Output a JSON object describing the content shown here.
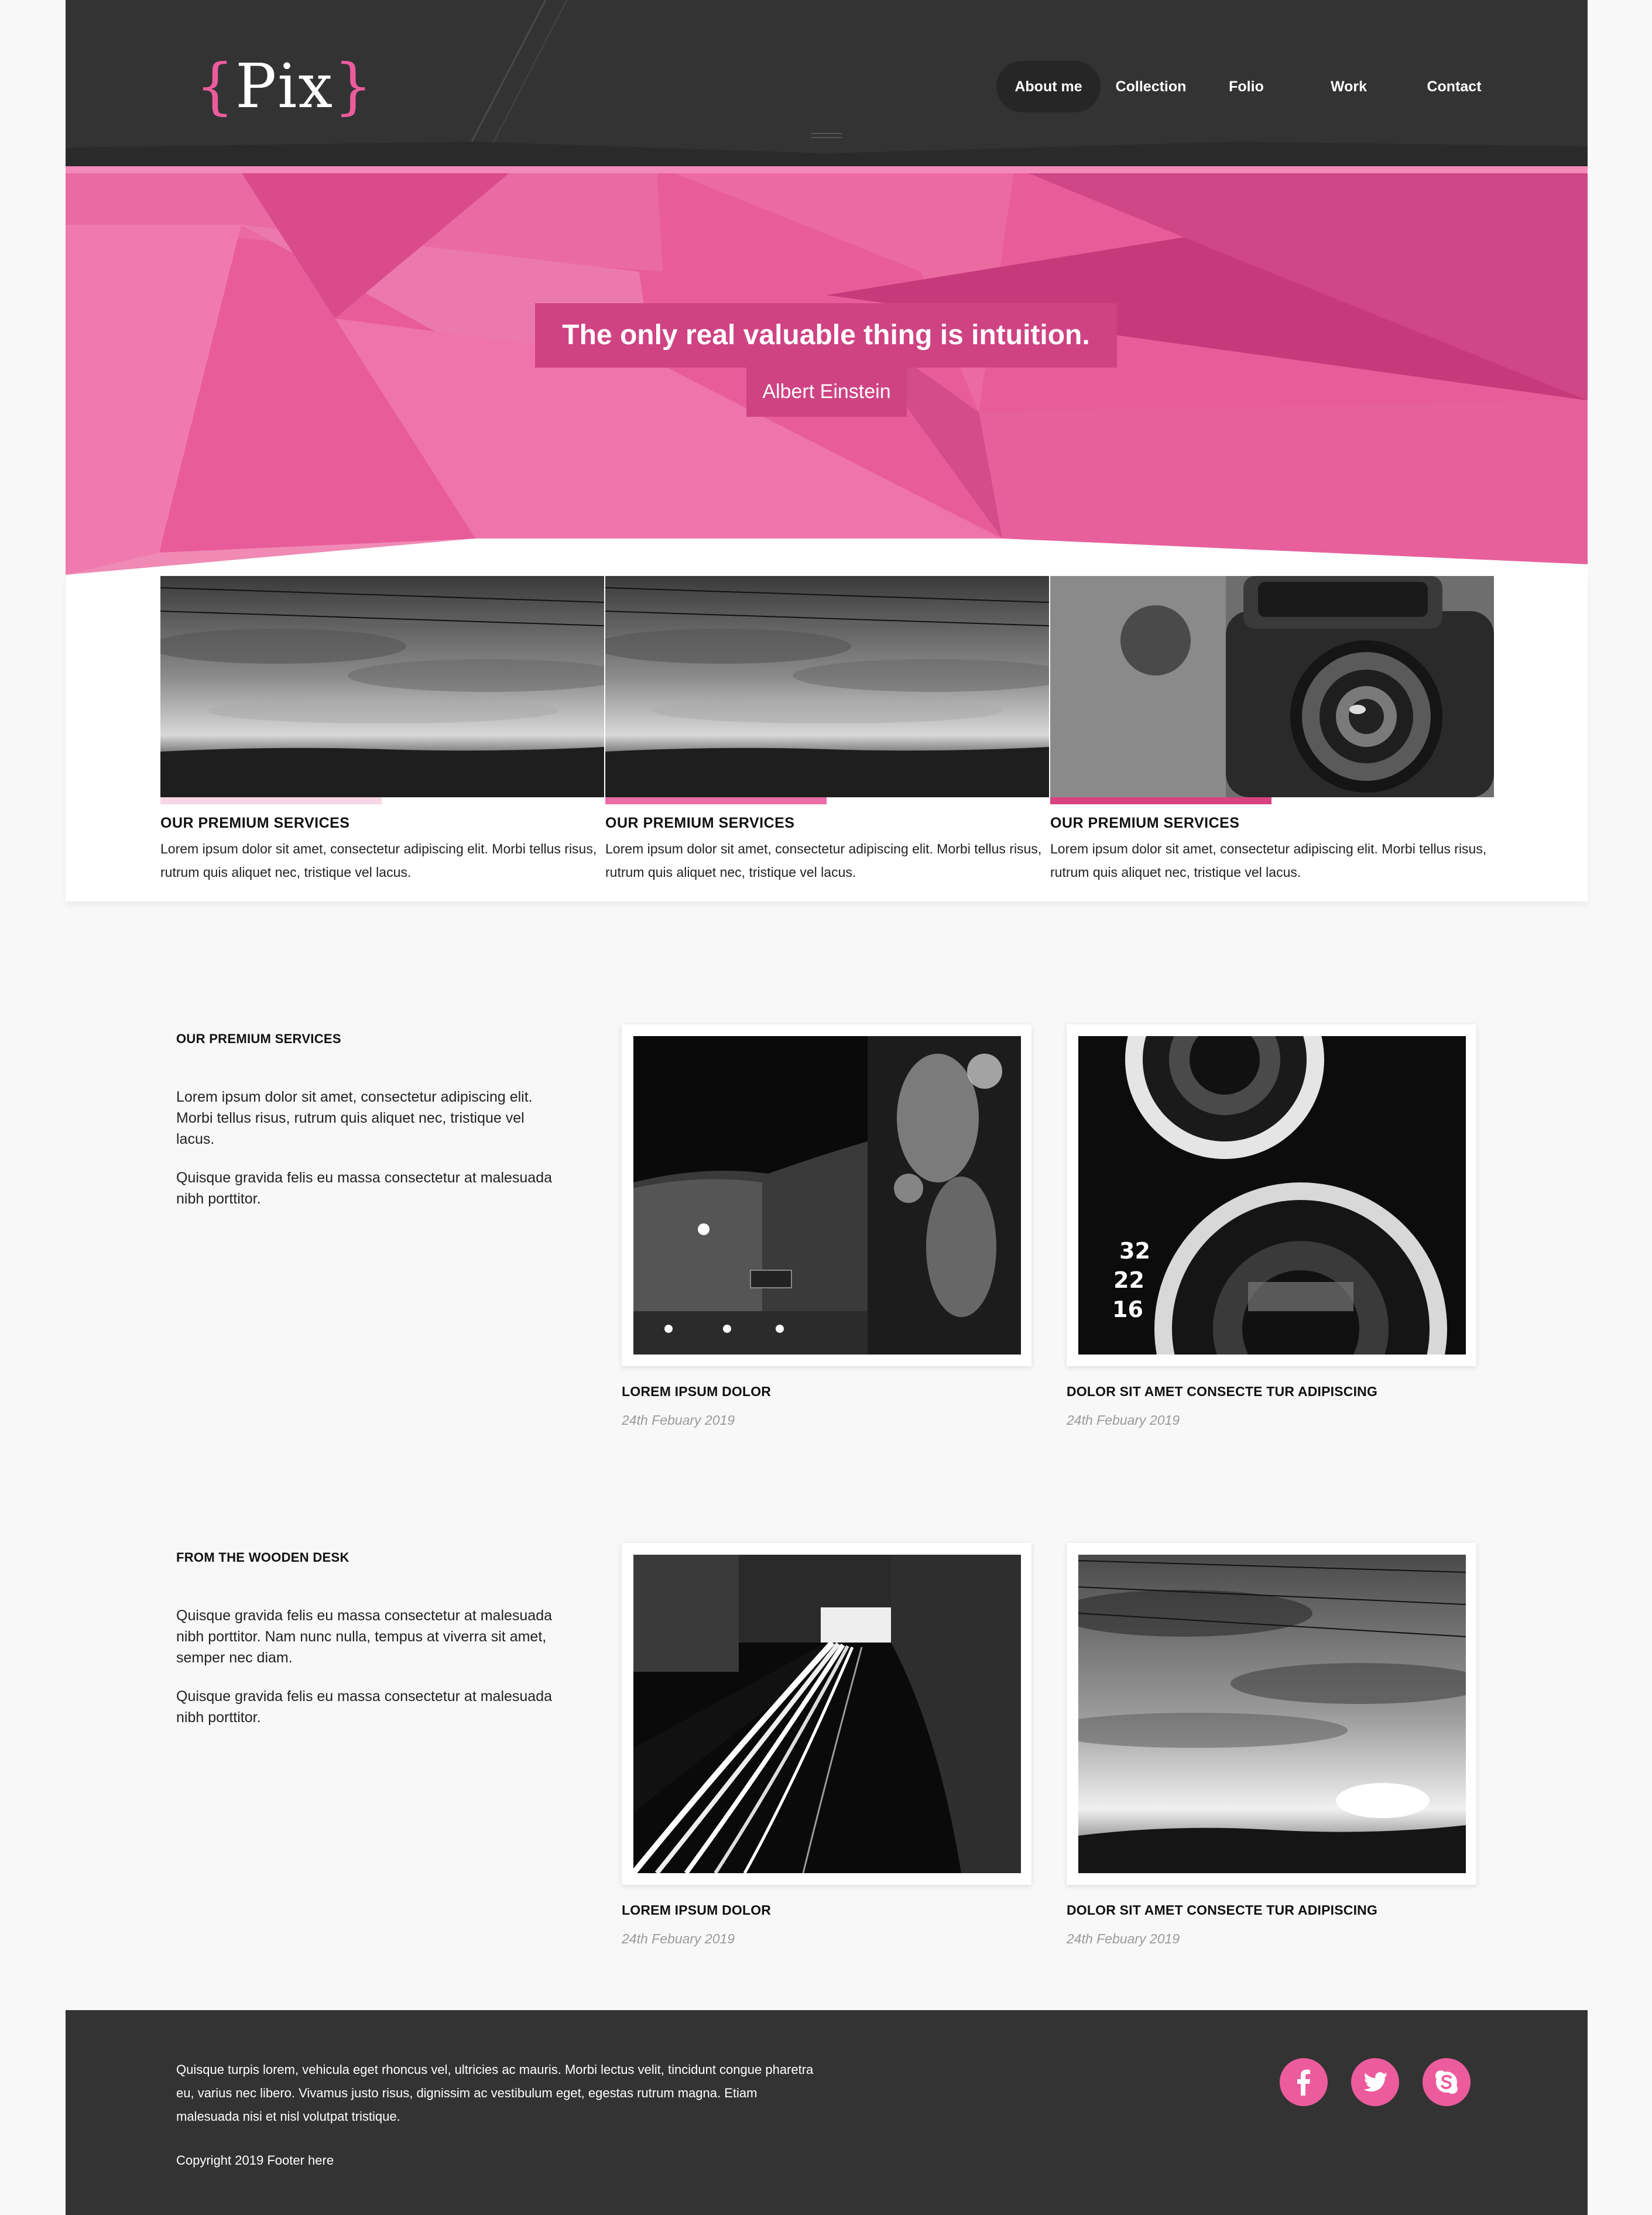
{
  "brand": {
    "logo_open": "{",
    "logo_text": "Pix",
    "logo_close": "}"
  },
  "nav": {
    "items": [
      {
        "label": "About me",
        "active": true
      },
      {
        "label": "Collection",
        "active": false
      },
      {
        "label": "Folio",
        "active": false
      },
      {
        "label": "Work",
        "active": false
      },
      {
        "label": "Contact",
        "active": false
      }
    ]
  },
  "hero": {
    "quote": "The only real valuable thing is intuition.",
    "author": "Albert Einstein"
  },
  "services": [
    {
      "title": "OUR PREMIUM SERVICES",
      "text": "Lorem ipsum dolor sit amet, consectetur adipiscing elit. Morbi tellus risus, rutrum quis aliquet nec, tristique vel lacus.",
      "image": "sunset-sky-photo",
      "bar_color": "#f7d6e5"
    },
    {
      "title": "OUR PREMIUM SERVICES",
      "text": "Lorem ipsum dolor sit amet, consectetur adipiscing elit. Morbi tellus risus, rutrum quis aliquet nec, tristique vel lacus.",
      "image": "sunset-sky-photo",
      "bar_color": "#ec6ca5"
    },
    {
      "title": "OUR PREMIUM SERVICES",
      "text": "Lorem ipsum dolor sit amet, consectetur adipiscing elit. Morbi tellus risus, rutrum quis aliquet nec, tristique vel lacus.",
      "image": "vintage-camera-photo",
      "bar_color": "#d9427f"
    }
  ],
  "section1": {
    "title": "OUR PREMIUM SERVICES",
    "paragraphs": [
      "Lorem ipsum dolor sit amet, consectetur adipiscing elit. Morbi tellus risus, rutrum quis aliquet nec, tristique vel lacus.",
      "Quisque gravida felis eu massa consectetur at malesuada nibh porttitor."
    ],
    "posts": [
      {
        "title": "LOREM IPSUM DOLOR",
        "date": "24th Febuary 2019",
        "image": "building-night-photo"
      },
      {
        "title": "DOLOR SIT AMET CONSECTE TUR ADIPISCING",
        "date": "24th Febuary 2019",
        "image": "camera-lens-closeup-photo"
      }
    ]
  },
  "section2": {
    "title": "FROM THE WOODEN DESK",
    "paragraphs": [
      "Quisque gravida felis eu massa consectetur at malesuada nibh porttitor. Nam nunc nulla, tempus at viverra sit amet, semper nec diam.",
      "Quisque gravida felis eu massa consectetur at malesuada nibh porttitor."
    ],
    "posts": [
      {
        "title": "LOREM IPSUM DOLOR",
        "date": "24th Febuary 2019",
        "image": "light-trails-photo"
      },
      {
        "title": "DOLOR SIT AMET CONSECTE TUR ADIPISCING",
        "date": "24th Febuary 2019",
        "image": "cloudy-sky-photo"
      }
    ]
  },
  "footer": {
    "text": "Quisque turpis lorem, vehicula eget rhoncus vel, ultricies ac mauris. Morbi lectus velit, tincidunt congue pharetra eu, varius nec libero. Vivamus justo risus, dignissim ac vestibulum eget, egestas rutrum magna. Etiam malesuada nisi et nisl volutpat tristique.",
    "copyright": "Copyright 2019 Footer here",
    "social": [
      "facebook-icon",
      "twitter-icon",
      "skype-icon"
    ]
  },
  "colors": {
    "accent": "#ec5c9d",
    "accent_dark": "#cf4383",
    "header_bg": "#333333",
    "page_bg": "#f8f8f8"
  }
}
